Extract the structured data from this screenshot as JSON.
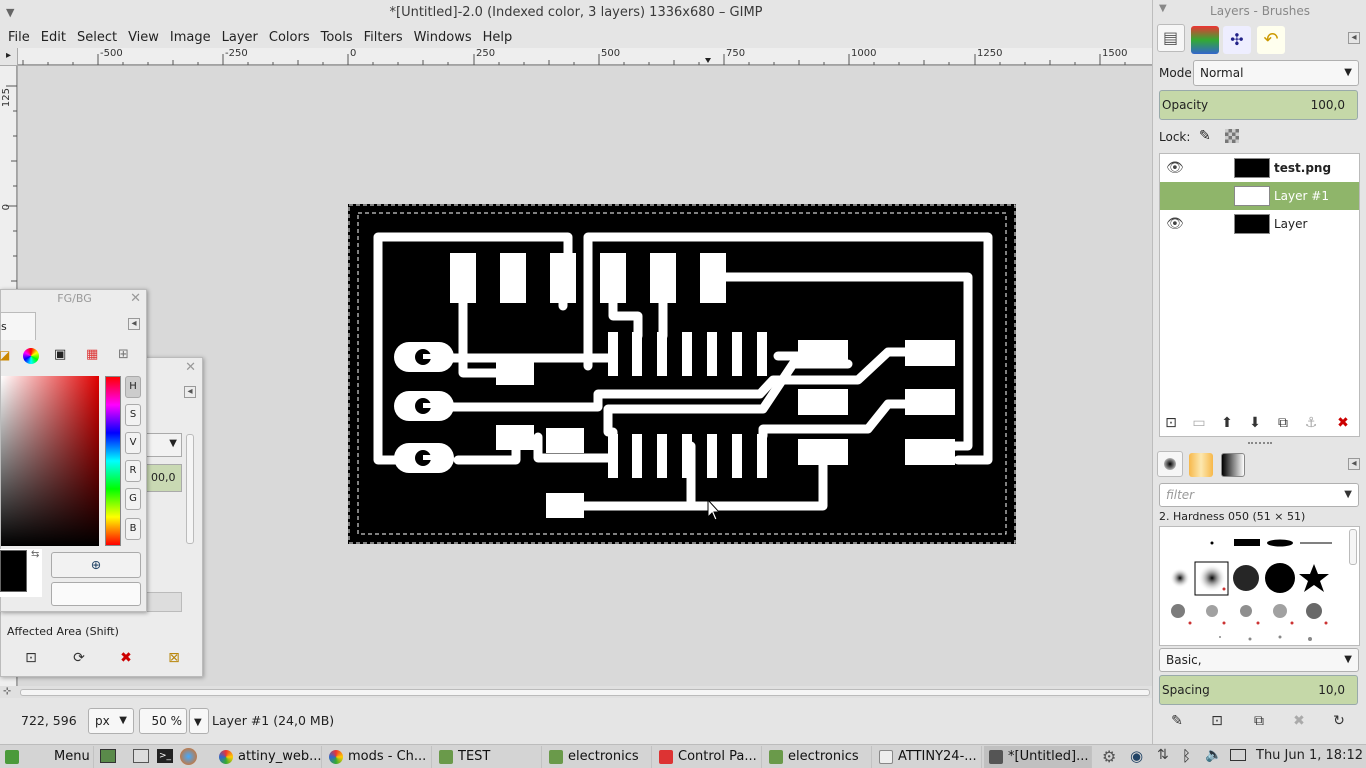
{
  "window": {
    "title": "*[Untitled]-2.0 (Indexed color, 3 layers) 1336x680 – GIMP",
    "menu_icon": "chevron-down-icon"
  },
  "menubar": [
    "File",
    "Edit",
    "Select",
    "View",
    "Image",
    "Layer",
    "Colors",
    "Tools",
    "Filters",
    "Windows",
    "Help"
  ],
  "ruler": {
    "labels": [
      "-500",
      "-250",
      "0",
      "250",
      "500",
      "750",
      "1000",
      "1250",
      "1500"
    ],
    "v_labels": [
      "125",
      "0"
    ]
  },
  "canvas": {
    "description_colors": {
      "board": "#000000",
      "trace": "#ffffff",
      "selection": "marching-ants"
    }
  },
  "statusbar": {
    "coords": "722, 596",
    "unit": "px",
    "zoom": "50 %",
    "layer_info": "Layer #1 (24,0 MB)"
  },
  "layers_dock": {
    "title": "Layers - Brushes",
    "mode_label": "Mode:",
    "mode_value": "Normal",
    "opacity_label": "Opacity",
    "opacity_value": "100,0",
    "lock_label": "Lock:",
    "layers": [
      {
        "name": "test.png",
        "visible": true,
        "selected": false
      },
      {
        "name": "Layer #1",
        "visible": false,
        "selected": true
      },
      {
        "name": "Layer",
        "visible": true,
        "selected": false
      }
    ]
  },
  "brushes_dock": {
    "filter_placeholder": "filter",
    "brush_name": "2. Hardness 050 (51 × 51)",
    "preset": "Basic,",
    "spacing_label": "Spacing",
    "spacing_value": "10,0"
  },
  "fgbg_dialog": {
    "title": "FG/BG",
    "tab_label": "s Color",
    "channels": [
      "H",
      "S",
      "V",
      "R",
      "G",
      "B"
    ]
  },
  "tool_options": {
    "value": "00,0",
    "affected_area": "Affected Area  (Shift)"
  },
  "taskbar": {
    "menu_label": "Menu",
    "tasks": [
      "attiny_web...",
      "mods - Ch...",
      "TEST",
      "electronics",
      "Control Pa...",
      "electronics",
      "ATTINY24-...",
      "*[Untitled]..."
    ],
    "clock": "Thu Jun  1, 18:12"
  },
  "colors": {
    "accent": "#9dbb74",
    "selected_layer": "#8fb56a",
    "taskbar": "#d4d4d4"
  }
}
